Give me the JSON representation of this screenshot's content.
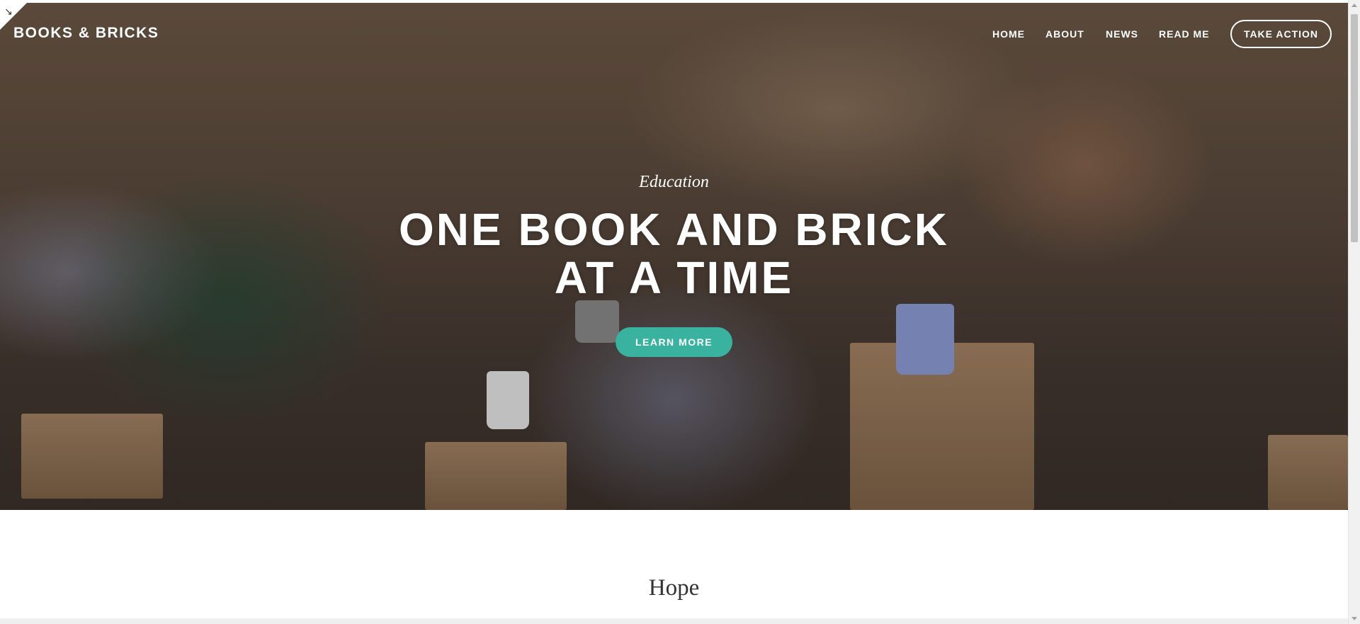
{
  "site": {
    "brand": "BOOKS & BRICKS"
  },
  "nav": {
    "items": [
      "HOME",
      "ABOUT",
      "NEWS",
      "READ ME"
    ],
    "cta": "TAKE ACTION"
  },
  "hero": {
    "kicker": "Education",
    "title_line1": "ONE BOOK AND BRICK",
    "title_line2": "AT A TIME",
    "button": "LEARN MORE",
    "image_description_icon": "photo-background"
  },
  "section": {
    "heading": "Hope"
  },
  "colors": {
    "accent": "#39b3a0",
    "text_light": "#ffffff",
    "heading_dark": "#333333"
  }
}
